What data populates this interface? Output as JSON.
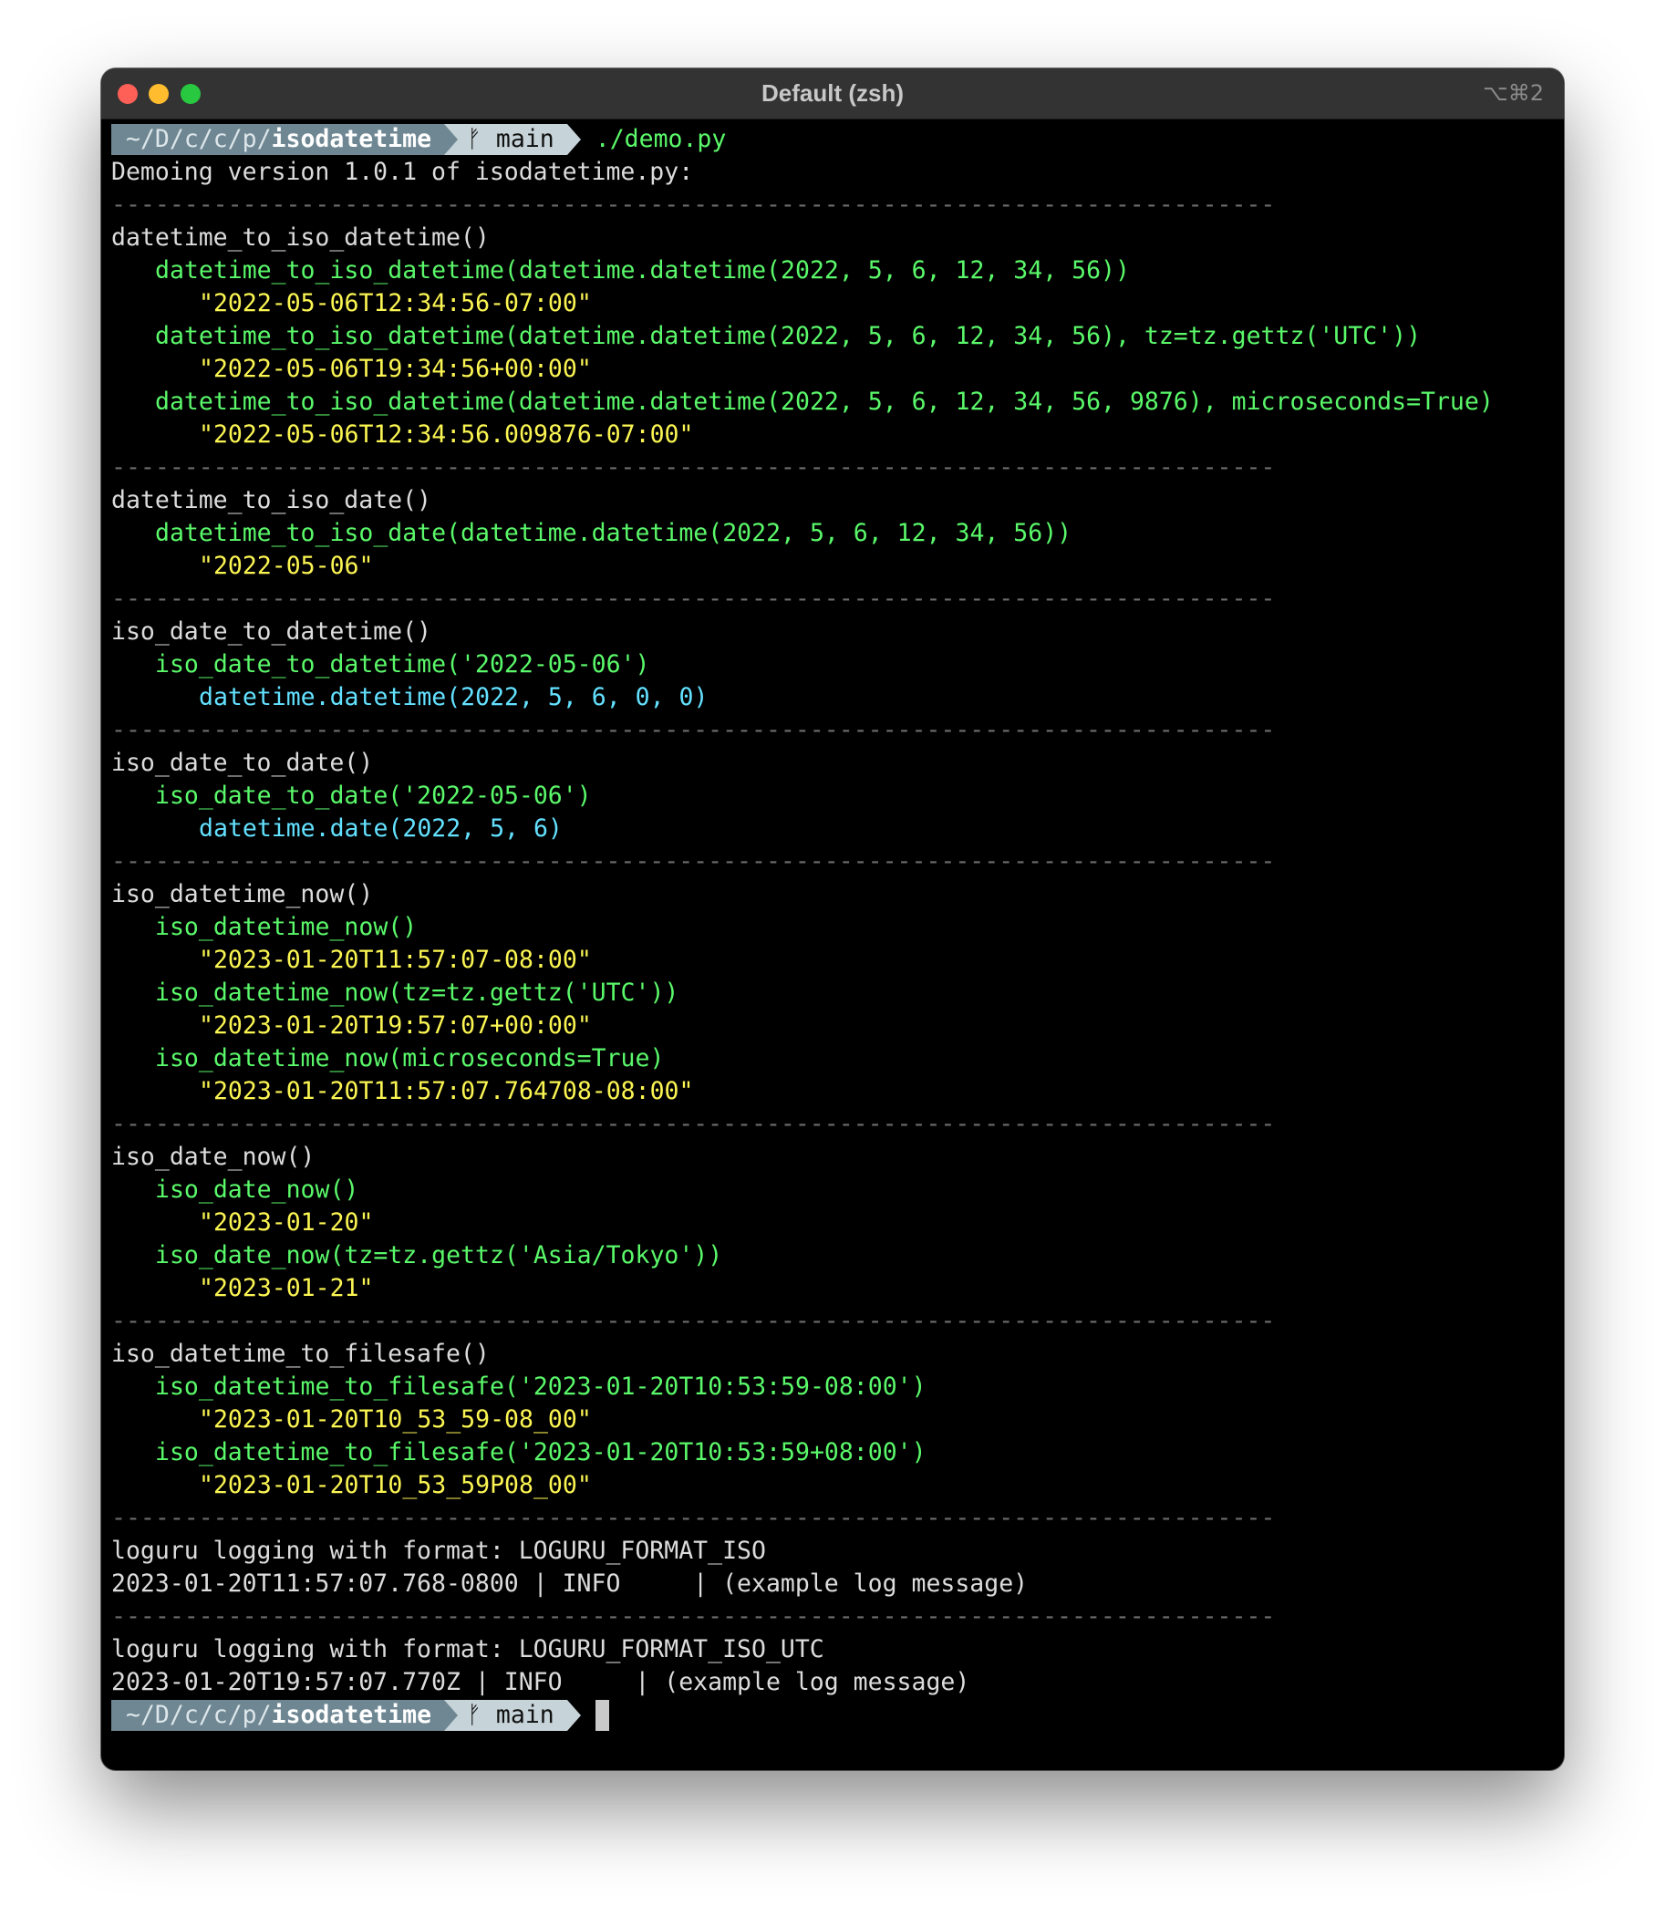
{
  "window": {
    "title": "Default (zsh)",
    "shortcut": "⌥⌘2"
  },
  "prompt": {
    "path_dim": "~/D/c/c/p/",
    "path_bold": "isodatetime",
    "branch_icon": "git-branch-icon",
    "branch_glyph": "ᚠ",
    "branch": "main",
    "command": "./demo.py"
  },
  "terminal": {
    "lines": [
      {
        "type": "text",
        "text": "Demoing version 1.0.1 of isodatetime.py:"
      },
      {
        "type": "rule"
      },
      {
        "type": "text",
        "text": "datetime_to_iso_datetime()"
      },
      {
        "type": "call",
        "text": "datetime_to_iso_datetime(datetime.datetime(2022, 5, 6, 12, 34, 56))"
      },
      {
        "type": "result",
        "text": "\"2022-05-06T12:34:56-07:00\""
      },
      {
        "type": "call",
        "text": "datetime_to_iso_datetime(datetime.datetime(2022, 5, 6, 12, 34, 56), tz=tz.gettz('UTC'))"
      },
      {
        "type": "result",
        "text": "\"2022-05-06T19:34:56+00:00\""
      },
      {
        "type": "call",
        "text": "datetime_to_iso_datetime(datetime.datetime(2022, 5, 6, 12, 34, 56, 9876), microseconds=True)"
      },
      {
        "type": "result",
        "text": "\"2022-05-06T12:34:56.009876-07:00\""
      },
      {
        "type": "rule"
      },
      {
        "type": "text",
        "text": "datetime_to_iso_date()"
      },
      {
        "type": "call",
        "text": "datetime_to_iso_date(datetime.datetime(2022, 5, 6, 12, 34, 56))"
      },
      {
        "type": "result",
        "text": "\"2022-05-06\""
      },
      {
        "type": "rule"
      },
      {
        "type": "text",
        "text": "iso_date_to_datetime()"
      },
      {
        "type": "call",
        "text": "iso_date_to_datetime('2022-05-06')"
      },
      {
        "type": "object",
        "text": "datetime.datetime(2022, 5, 6, 0, 0)"
      },
      {
        "type": "rule"
      },
      {
        "type": "text",
        "text": "iso_date_to_date()"
      },
      {
        "type": "call",
        "text": "iso_date_to_date('2022-05-06')"
      },
      {
        "type": "object",
        "text": "datetime.date(2022, 5, 6)"
      },
      {
        "type": "rule"
      },
      {
        "type": "text",
        "text": "iso_datetime_now()"
      },
      {
        "type": "call",
        "text": "iso_datetime_now()"
      },
      {
        "type": "result",
        "text": "\"2023-01-20T11:57:07-08:00\""
      },
      {
        "type": "call",
        "text": "iso_datetime_now(tz=tz.gettz('UTC'))"
      },
      {
        "type": "result",
        "text": "\"2023-01-20T19:57:07+00:00\""
      },
      {
        "type": "call",
        "text": "iso_datetime_now(microseconds=True)"
      },
      {
        "type": "result",
        "text": "\"2023-01-20T11:57:07.764708-08:00\""
      },
      {
        "type": "rule"
      },
      {
        "type": "text",
        "text": "iso_date_now()"
      },
      {
        "type": "call",
        "text": "iso_date_now()"
      },
      {
        "type": "result",
        "text": "\"2023-01-20\""
      },
      {
        "type": "call",
        "text": "iso_date_now(tz=tz.gettz('Asia/Tokyo'))"
      },
      {
        "type": "result",
        "text": "\"2023-01-21\""
      },
      {
        "type": "rule"
      },
      {
        "type": "text",
        "text": "iso_datetime_to_filesafe()"
      },
      {
        "type": "call",
        "text": "iso_datetime_to_filesafe('2023-01-20T10:53:59-08:00')"
      },
      {
        "type": "result",
        "text": "\"2023-01-20T10_53_59-08_00\""
      },
      {
        "type": "call",
        "text": "iso_datetime_to_filesafe('2023-01-20T10:53:59+08:00')"
      },
      {
        "type": "result",
        "text": "\"2023-01-20T10_53_59P08_00\""
      },
      {
        "type": "rule"
      },
      {
        "type": "text",
        "text": "loguru logging with format: LOGURU_FORMAT_ISO"
      },
      {
        "type": "text",
        "text": "2023-01-20T11:57:07.768-0800 | INFO     | (example log message)"
      },
      {
        "type": "rule"
      },
      {
        "type": "text",
        "text": "loguru logging with format: LOGURU_FORMAT_ISO_UTC"
      },
      {
        "type": "text",
        "text": "2023-01-20T19:57:07.770Z | INFO     | (example log message)"
      }
    ],
    "rule_text": "--------------------------------------------------------------------------------"
  },
  "colors": {
    "background": "#000000",
    "titlebar": "#333333",
    "plain_text": "#dcdcdc",
    "call_green": "#5af86a",
    "result_yellow": "#fbf552",
    "object_cyan": "#63e1ff",
    "prompt_path_bg": "#6e8792",
    "prompt_branch_bg": "#c6d3d8"
  }
}
